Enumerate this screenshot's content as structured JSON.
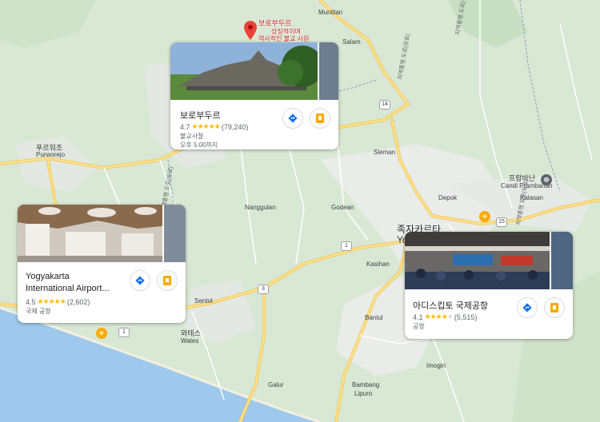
{
  "places": {
    "borobudur": {
      "pin_name": "보로부두르",
      "pin_sub1": "상징적이며",
      "pin_sub2": "역사적인 불교 사원",
      "title": "보로부두르",
      "rating": "4.7",
      "reviews": "(79,240)",
      "category": "불교사찰",
      "hours": "오후 5:00까지"
    },
    "yia": {
      "title1": "Yogyakarta",
      "title2": "International Airport...",
      "rating": "4.5",
      "reviews": "(2,602)",
      "category": "국제 공항"
    },
    "adisucipto": {
      "title": "아디스킵토 국제공항",
      "rating": "4.1",
      "reviews": "(5,515)",
      "category": "공항"
    }
  },
  "towns": {
    "muntilan": "Muntilan",
    "salam": "Salam",
    "purworejo_ko": "푸르워조",
    "purworejo": "Purworejo",
    "sleman": "Sleman",
    "depok": "Depok",
    "prambanan_ko": "프람바난",
    "prambanan": "Candi Prambanan",
    "kalasan": "Kalasan",
    "nanggulan": "Nanggulan",
    "godean": "Godean",
    "yogya_ko": "족자카르타",
    "yogya": "Yo",
    "kasihan": "Kasihan",
    "sentolo": "Sentol",
    "wates_ko": "와테스",
    "wates": "Wates",
    "bantul": "Bantul",
    "imogiri": "Imogiri",
    "galur": "Galur",
    "bambang": "Bambang",
    "lipuro": "Lipuro"
  },
  "roads": {
    "r14": "14",
    "r15": "15",
    "r1a": "1",
    "r1b": "1",
    "r3": "3",
    "toll1": "지역통행 도로(유료)",
    "toll2": "지역통행 도로(유료)",
    "toll3": "지역통행 도로(유료)",
    "toll4": "지역통행 도로(유료)"
  },
  "colors": {
    "land": "#d9e8d4",
    "urban": "#e8ecea",
    "sea": "#9fc9ec",
    "road": "#fde293",
    "road_edge": "#f2c44a",
    "star": "#fbbc04",
    "direction": "#1a73e8",
    "save": "#f9ab00"
  },
  "icons": {
    "direction": "directions-icon",
    "save": "bookmark-icon",
    "pin": "map-pin-icon",
    "airport": "airport-marker-icon"
  }
}
